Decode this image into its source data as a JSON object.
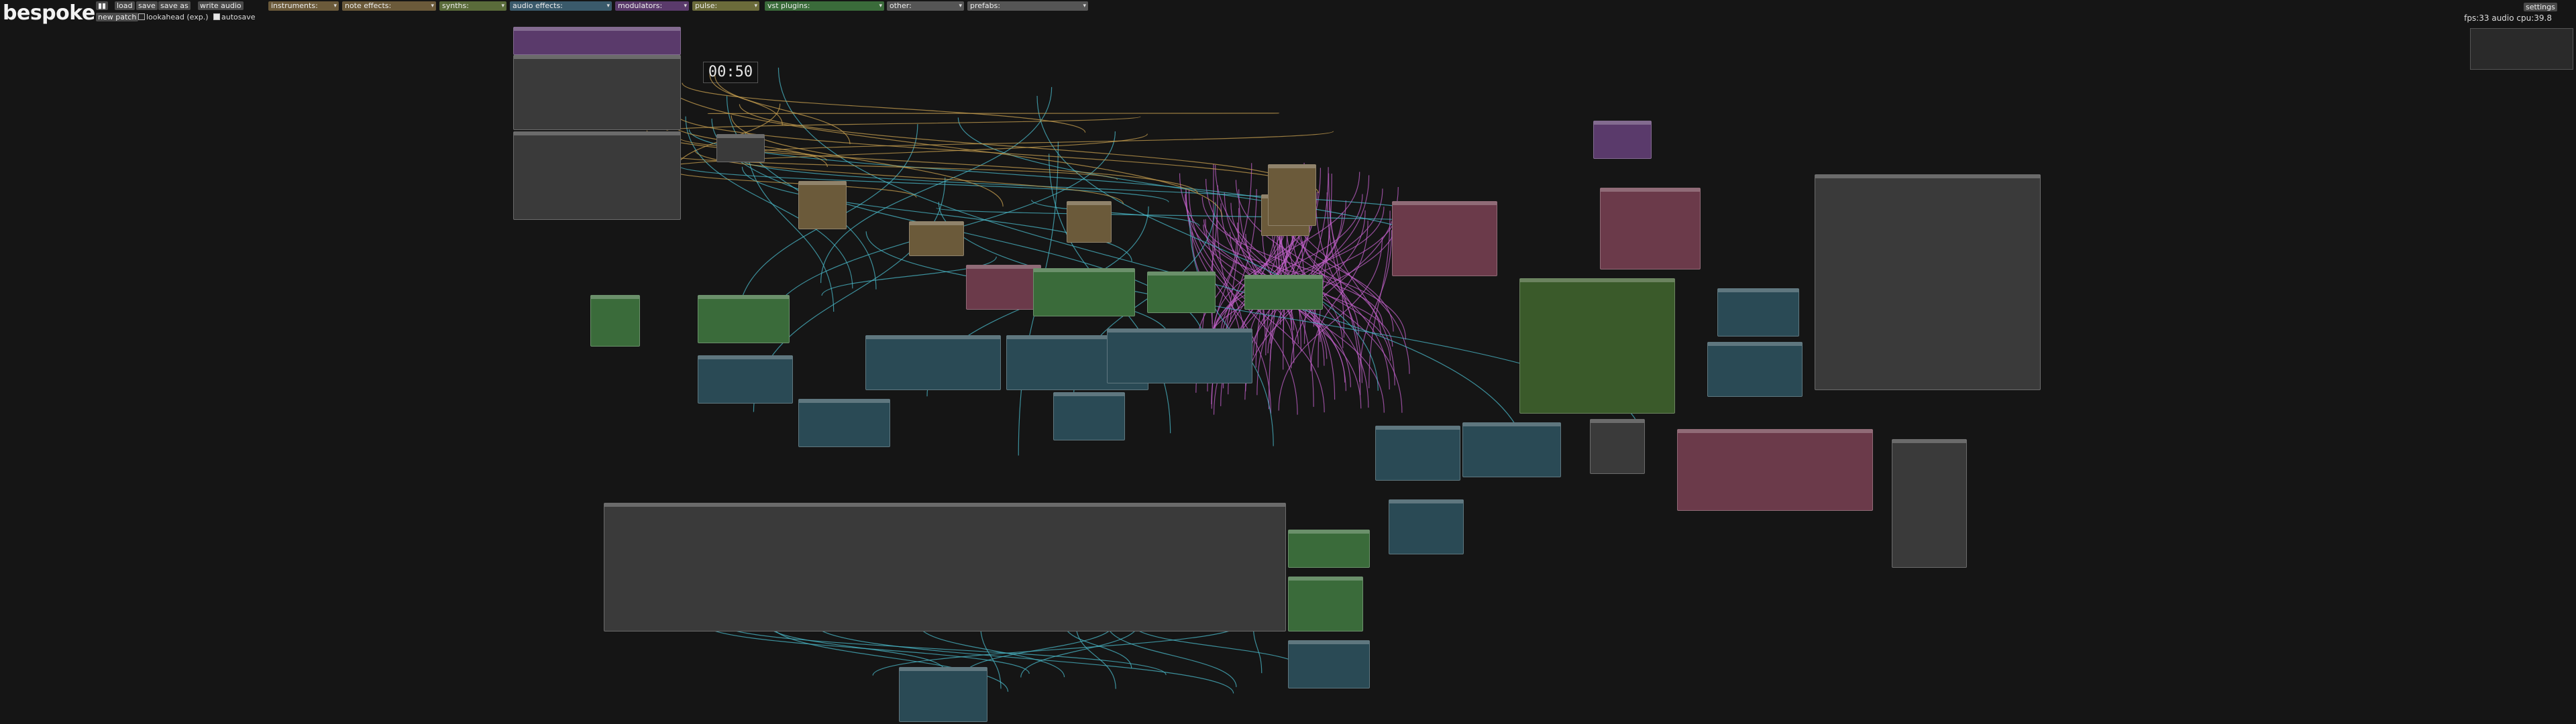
{
  "app": {
    "title": "bespoke"
  },
  "toolbar": {
    "load_label": "load",
    "save_label": "save",
    "save_as_label": "save as",
    "write_audio_label": "write audio",
    "new_patch_label": "new patch",
    "lookahead_label": "lookahead (exp.)",
    "autosave_label": "autosave",
    "settings_label": "settings"
  },
  "categories": [
    {
      "label": "instruments:",
      "color": "#6b5a3a"
    },
    {
      "label": "note effects:",
      "color": "#6b5a3a"
    },
    {
      "label": "synths:",
      "color": "#5a6b3a"
    },
    {
      "label": "audio effects:",
      "color": "#3a5a6b"
    },
    {
      "label": "modulators:",
      "color": "#5a3a6b"
    },
    {
      "label": "pulse:",
      "color": "#6b6b3a"
    },
    {
      "label": "vst plugins:",
      "color": "#3a6b3a"
    },
    {
      "label": "other:",
      "color": "#555555"
    },
    {
      "label": "prefabs:",
      "color": "#555555"
    }
  ],
  "status": {
    "fps": "fps:33",
    "cpu": "audio cpu:39.8"
  },
  "transport": {
    "time": "00:50"
  },
  "colors": {
    "background": "#151515",
    "note": "#c8a050",
    "audio": "#4ab8c8",
    "modulation": "#c060c8",
    "synth": "#7ab84a",
    "pulse": "#e0c040"
  }
}
